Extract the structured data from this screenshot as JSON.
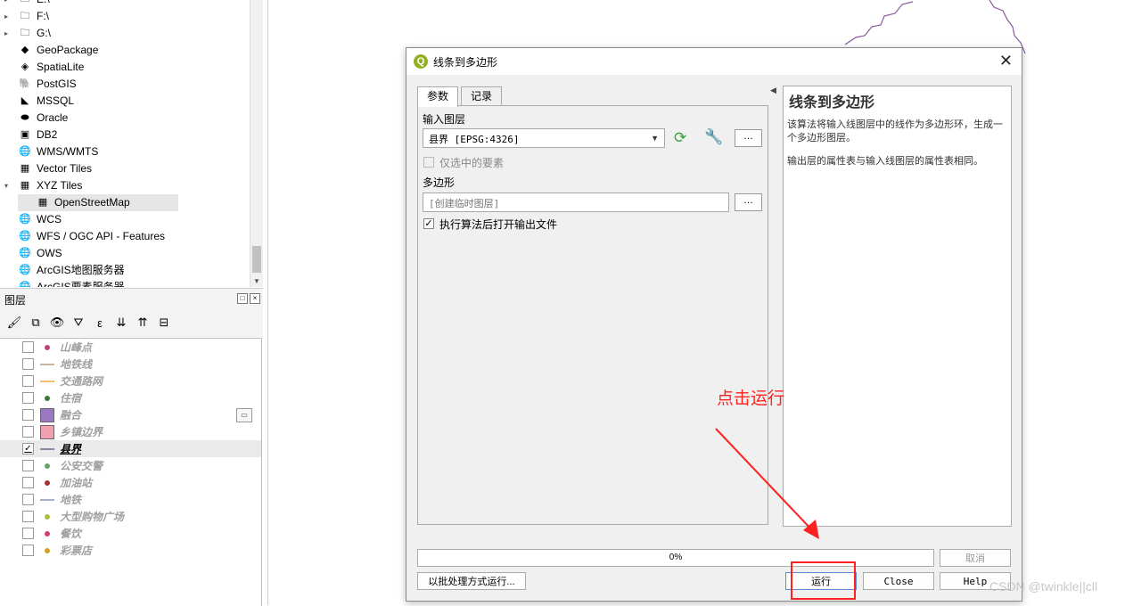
{
  "browser": {
    "items": [
      {
        "label": "E:\\",
        "icon": "folder-icon",
        "expander": "▸"
      },
      {
        "label": "F:\\",
        "icon": "folder-icon",
        "expander": "▸"
      },
      {
        "label": "G:\\",
        "icon": "folder-icon",
        "expander": "▸"
      },
      {
        "label": "GeoPackage",
        "icon": "geopackage-icon",
        "expander": ""
      },
      {
        "label": "SpatiaLite",
        "icon": "spatialite-icon",
        "expander": ""
      },
      {
        "label": "PostGIS",
        "icon": "postgis-icon",
        "expander": ""
      },
      {
        "label": "MSSQL",
        "icon": "mssql-icon",
        "expander": ""
      },
      {
        "label": "Oracle",
        "icon": "oracle-icon",
        "expander": ""
      },
      {
        "label": "DB2",
        "icon": "db2-icon",
        "expander": ""
      },
      {
        "label": "WMS/WMTS",
        "icon": "wms-globe-icon",
        "expander": ""
      },
      {
        "label": "Vector Tiles",
        "icon": "vector-tiles-icon",
        "expander": ""
      },
      {
        "label": "XYZ Tiles",
        "icon": "xyz-tiles-icon",
        "expander": "▾"
      },
      {
        "label": "OpenStreetMap",
        "icon": "xyz-tiles-icon",
        "expander": "",
        "child": true,
        "selected": true
      },
      {
        "label": "WCS",
        "icon": "wcs-globe-icon",
        "expander": ""
      },
      {
        "label": "WFS / OGC API - Features",
        "icon": "wfs-globe-icon",
        "expander": ""
      },
      {
        "label": "OWS",
        "icon": "ows-globe-icon",
        "expander": ""
      },
      {
        "label": "ArcGIS地图服务器",
        "icon": "arcgis-globe-icon",
        "expander": ""
      },
      {
        "label": "ArcGIS要素服务器",
        "icon": "arcgis-globe-icon",
        "expander": ""
      }
    ]
  },
  "layers": {
    "title": "图层",
    "toolbar": [
      "style-brush-icon",
      "add-group-icon",
      "visibility-eye-icon",
      "filter-icon",
      "expression-filter-icon",
      "expand-all-icon",
      "collapse-all-icon",
      "remove-layer-icon"
    ],
    "items": [
      {
        "name": "山峰点",
        "symbol": "dot",
        "color": "#c0407a",
        "checked": false
      },
      {
        "name": "地铁线",
        "symbol": "line",
        "color": "#c8b4a0",
        "checked": false
      },
      {
        "name": "交通路网",
        "symbol": "line",
        "color": "#f0c070",
        "checked": false
      },
      {
        "name": "住宿",
        "symbol": "dot",
        "color": "#3a7a3a",
        "checked": false
      },
      {
        "name": "融合",
        "symbol": "fill",
        "color": "#9b79c2",
        "checked": false
      },
      {
        "name": "乡镇边界",
        "symbol": "fill",
        "color": "#f2a0b0",
        "checked": false
      },
      {
        "name": "县界",
        "symbol": "line",
        "color": "#8a86a8",
        "checked": true,
        "active": true
      },
      {
        "name": "公安交警",
        "symbol": "dot",
        "color": "#6aa06a",
        "checked": false
      },
      {
        "name": "加油站",
        "symbol": "dot",
        "color": "#a83030",
        "checked": false
      },
      {
        "name": "地铁",
        "symbol": "line",
        "color": "#a8b0c8",
        "checked": false
      },
      {
        "name": "大型购物广场",
        "symbol": "dot",
        "color": "#a8c040",
        "checked": false
      },
      {
        "name": "餐饮",
        "symbol": "dot",
        "color": "#d04070",
        "checked": false
      },
      {
        "name": "彩票店",
        "symbol": "dot",
        "color": "#d4a020",
        "checked": false
      }
    ]
  },
  "dialog": {
    "title": "线条到多边形",
    "close": "✕",
    "tabs": {
      "params": "参数",
      "log": "记录"
    },
    "input_label": "输入图层",
    "input_value": "县界 [EPSG:4326]",
    "selected_only": "仅选中的要素",
    "output_label": "多边形",
    "output_placeholder": "[创建临时图层]",
    "open_after": "执行算法后打开输出文件",
    "dots": "…",
    "help_title": "线条到多边形",
    "help_p1": "该算法将输入线图层中的线作为多边形环，生成一个多边形图层。",
    "help_p2": "输出层的属性表与输入线图层的属性表相同。",
    "progress": "0%",
    "cancel": "取消",
    "batch": "以批处理方式运行...",
    "run": "运行",
    "close_btn": "Close",
    "help_btn": "Help"
  },
  "annotation": {
    "text": "点击运行",
    "color": "#ff2020"
  },
  "watermark": "CSDN @twinkle||cll"
}
